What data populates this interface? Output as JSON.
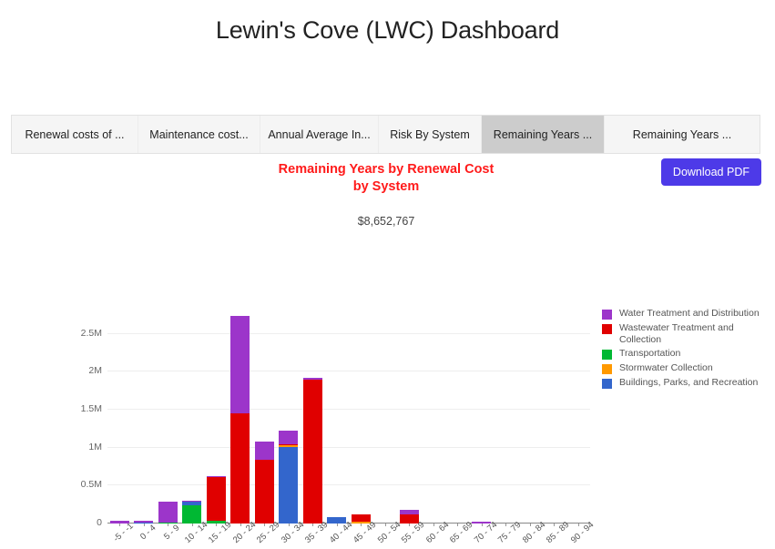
{
  "header": {
    "title": "Lewin's Cove (LWC) Dashboard"
  },
  "tabs": [
    {
      "label": "Renewal costs of ...",
      "selected": false
    },
    {
      "label": "Maintenance cost...",
      "selected": false
    },
    {
      "label": "Annual Average In...",
      "selected": false
    },
    {
      "label": "Risk By System",
      "selected": false
    },
    {
      "label": "Remaining Years ...",
      "selected": true
    },
    {
      "label": "Remaining Years ...",
      "selected": false
    }
  ],
  "toolbar": {
    "download_label": "Download PDF",
    "download_color": "#4d3ae8"
  },
  "panel": {
    "title": "Remaining Years by Renewal Cost by System",
    "title_color": "#ff1a1a",
    "total": "$8,652,767"
  },
  "chart_data": {
    "type": "bar",
    "stacked": true,
    "title": "Remaining Years by Renewal Cost by System",
    "xlabel": "",
    "ylabel": "",
    "ylim": [
      0,
      2750000
    ],
    "grid": true,
    "legend_position": "right",
    "ytick_labels": [
      "2.5M",
      "2M",
      "1.5M",
      "1M",
      "0.5M",
      "0"
    ],
    "ytick_values": [
      2500000,
      2000000,
      1500000,
      1000000,
      500000,
      0
    ],
    "categories": [
      "-5 - -1",
      "0 - 4",
      "5 - 9",
      "10 - 14",
      "15 - 19",
      "20 - 24",
      "25 - 29",
      "30 - 34",
      "35 - 39",
      "40 - 44",
      "45 - 49",
      "50 - 54",
      "55 - 59",
      "60 - 64",
      "65 - 69",
      "70 - 74",
      "75 - 79",
      "80 - 84",
      "85 - 89",
      "90 - 94"
    ],
    "series": [
      {
        "name": "Water Treatment and Distribution",
        "color": "#9c35ca",
        "values": [
          32000,
          10000,
          275000,
          8000,
          12000,
          1290000,
          240000,
          185000,
          25000,
          0,
          0,
          0,
          62000,
          0,
          0,
          28000,
          0,
          0,
          0,
          0
        ]
      },
      {
        "name": "Wastewater Treatment and Collection",
        "color": "#e00000",
        "values": [
          0,
          0,
          0,
          0,
          570000,
          1450000,
          845000,
          10000,
          1900000,
          0,
          95000,
          0,
          120000,
          0,
          0,
          0,
          0,
          0,
          0,
          0
        ]
      },
      {
        "name": "Transportation",
        "color": "#00b833",
        "values": [
          0,
          0,
          14000,
          245000,
          42000,
          0,
          0,
          0,
          0,
          0,
          0,
          0,
          0,
          0,
          0,
          0,
          0,
          0,
          0,
          0
        ]
      },
      {
        "name": "Stormwater Collection",
        "color": "#ff9900",
        "values": [
          0,
          0,
          0,
          0,
          0,
          0,
          0,
          18000,
          0,
          0,
          30000,
          0,
          0,
          0,
          0,
          0,
          0,
          0,
          0,
          0
        ]
      },
      {
        "name": "Buildings, Parks, and Recreation",
        "color": "#3366cc",
        "values": [
          0,
          18000,
          0,
          38000,
          0,
          0,
          0,
          1010000,
          0,
          80000,
          0,
          0,
          0,
          0,
          0,
          0,
          0,
          0,
          0,
          0
        ]
      }
    ]
  }
}
